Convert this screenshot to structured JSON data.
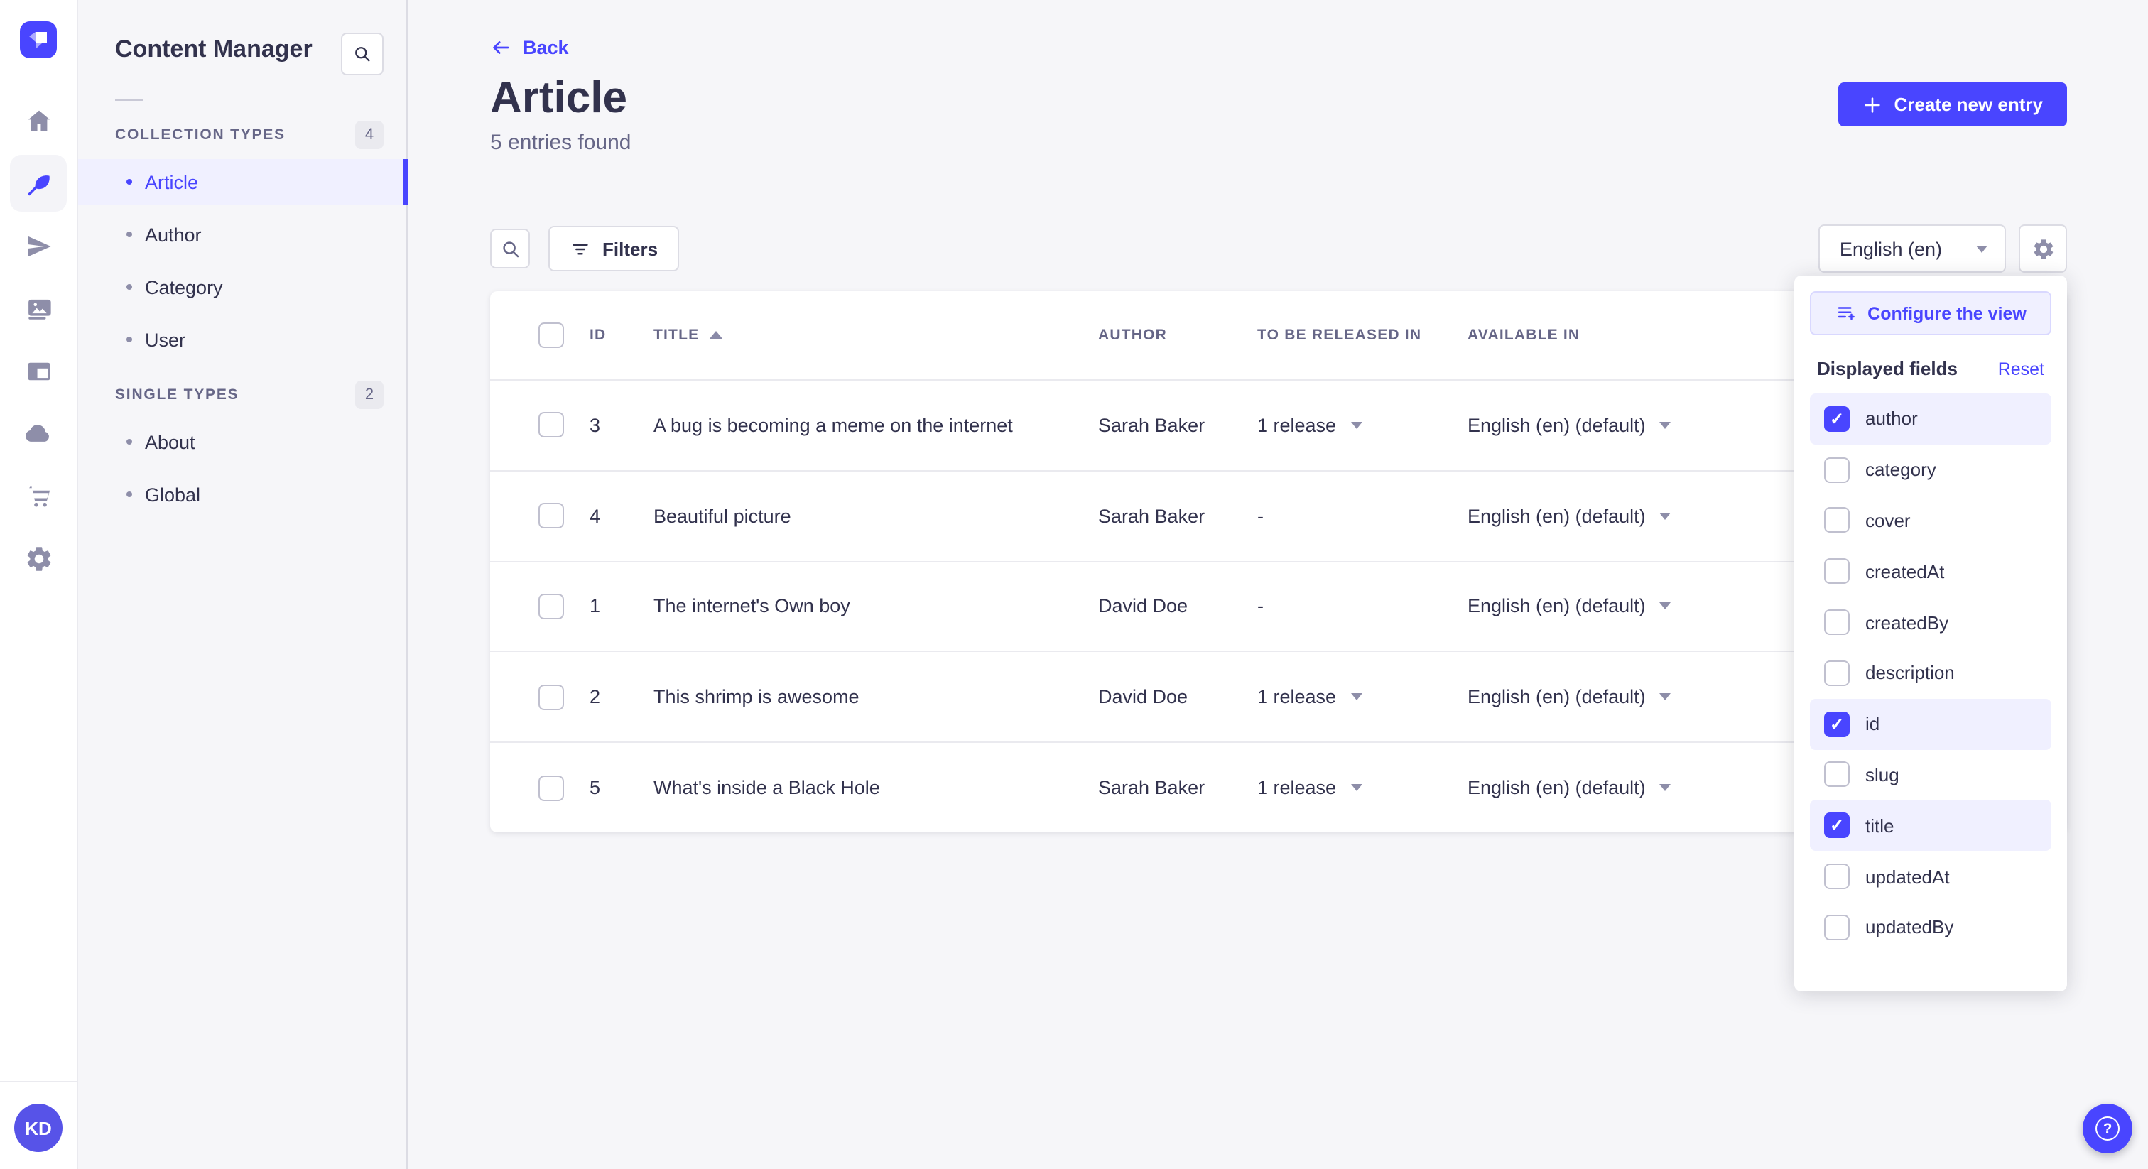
{
  "colors": {
    "primary": "#4945ff",
    "primary_bg": "#f0f0ff",
    "primary_border": "#d9d8ff",
    "text": "#32324d",
    "muted": "#666687",
    "icon_gray": "#8e8ea9",
    "border": "#dcdce4",
    "row_border": "#eaeaef",
    "page_bg": "#f6f6f9",
    "avatar_bg": "#5753e8"
  },
  "rail": {
    "logo_icon": "strapi-logo",
    "icons": [
      {
        "name": "home-icon",
        "active": false
      },
      {
        "name": "content-manager-icon",
        "active": true
      },
      {
        "name": "releases-icon",
        "active": false
      },
      {
        "name": "media-library-icon",
        "active": false
      },
      {
        "name": "content-type-builder-icon",
        "active": false
      },
      {
        "name": "deploy-cloud-icon",
        "active": false
      },
      {
        "name": "marketplace-icon",
        "active": false
      },
      {
        "name": "settings-icon",
        "active": false
      }
    ],
    "avatar_initials": "KD",
    "help_glyph": "?"
  },
  "sidebar": {
    "title": "Content Manager",
    "sections": [
      {
        "label": "COLLECTION TYPES",
        "badge": "4",
        "items": [
          {
            "label": "Article",
            "active": true
          },
          {
            "label": "Author",
            "active": false
          },
          {
            "label": "Category",
            "active": false
          },
          {
            "label": "User",
            "active": false
          }
        ]
      },
      {
        "label": "SINGLE TYPES",
        "badge": "2",
        "items": [
          {
            "label": "About",
            "active": false
          },
          {
            "label": "Global",
            "active": false
          }
        ]
      }
    ]
  },
  "header": {
    "back_label": "Back",
    "title": "Article",
    "subtitle": "5 entries found",
    "create_label": "Create new entry"
  },
  "toolbar": {
    "filters_label": "Filters",
    "locale_value": "English (en)"
  },
  "table": {
    "headers": {
      "id": "ID",
      "title": "TITLE",
      "author": "AUTHOR",
      "release": "TO BE RELEASED IN",
      "available": "AVAILABLE IN"
    },
    "sort_column": "TITLE",
    "sort_direction": "asc",
    "rows": [
      {
        "id": "3",
        "title": "A bug is becoming a meme on the internet",
        "author": "Sarah Baker",
        "release": "1 release",
        "has_release": true,
        "available": "English (en) (default)"
      },
      {
        "id": "4",
        "title": "Beautiful picture",
        "author": "Sarah Baker",
        "release": "-",
        "has_release": false,
        "available": "English (en) (default)"
      },
      {
        "id": "1",
        "title": "The internet's Own boy",
        "author": "David Doe",
        "release": "-",
        "has_release": false,
        "available": "English (en) (default)"
      },
      {
        "id": "2",
        "title": "This shrimp is awesome",
        "author": "David Doe",
        "release": "1 release",
        "has_release": true,
        "available": "English (en) (default)"
      },
      {
        "id": "5",
        "title": "What's inside a Black Hole",
        "author": "Sarah Baker",
        "release": "1 release",
        "has_release": true,
        "available": "English (en) (default)"
      }
    ]
  },
  "popover": {
    "configure_label": "Configure the view",
    "fields_label": "Displayed fields",
    "reset_label": "Reset",
    "fields": [
      {
        "label": "author",
        "checked": true
      },
      {
        "label": "category",
        "checked": false
      },
      {
        "label": "cover",
        "checked": false
      },
      {
        "label": "createdAt",
        "checked": false
      },
      {
        "label": "createdBy",
        "checked": false
      },
      {
        "label": "description",
        "checked": false
      },
      {
        "label": "id",
        "checked": true
      },
      {
        "label": "slug",
        "checked": false
      },
      {
        "label": "title",
        "checked": true
      },
      {
        "label": "updatedAt",
        "checked": false
      },
      {
        "label": "updatedBy",
        "checked": false
      }
    ]
  }
}
